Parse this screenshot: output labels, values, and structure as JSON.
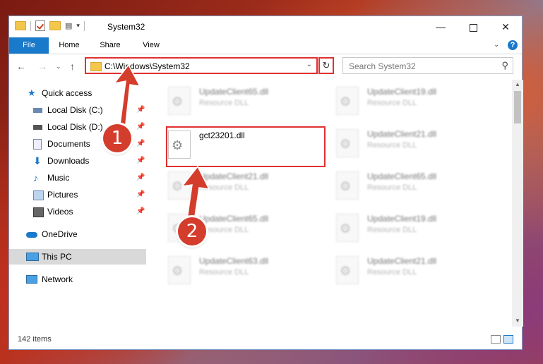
{
  "window": {
    "title": "System32",
    "controls": {
      "minimize": "—",
      "maximize": "",
      "close": "✕"
    }
  },
  "ribbon": {
    "tabs": [
      "File",
      "Home",
      "Share",
      "View"
    ],
    "help": "?"
  },
  "nav": {
    "address_path": "C:\\Windows\\System32",
    "search_placeholder": "Search System32"
  },
  "sidebar": {
    "items": [
      {
        "label": "Quick access",
        "icon": "star-icon"
      },
      {
        "label": "Local Disk (C:)",
        "icon": "drive-icon",
        "pinned": true
      },
      {
        "label": "Local Disk (D:)",
        "icon": "drive-icon",
        "pinned": true
      },
      {
        "label": "Documents",
        "icon": "documents-icon",
        "pinned": true
      },
      {
        "label": "Downloads",
        "icon": "download-icon",
        "pinned": true
      },
      {
        "label": "Music",
        "icon": "music-icon",
        "pinned": true
      },
      {
        "label": "Pictures",
        "icon": "pictures-icon",
        "pinned": true
      },
      {
        "label": "Videos",
        "icon": "videos-icon",
        "pinned": true
      },
      {
        "label": "OneDrive",
        "icon": "cloud-icon"
      },
      {
        "label": "This PC",
        "icon": "computer-icon",
        "selected": true
      },
      {
        "label": "Network",
        "icon": "network-icon"
      }
    ]
  },
  "files": [
    {
      "name": "UpdateClient65.dll",
      "type": "Resource DLL",
      "blurred": true
    },
    {
      "name": "UpdateClient19.dll",
      "type": "Resource DLL",
      "blurred": true
    },
    {
      "name": "gct23201.dll",
      "type": "",
      "blurred": false
    },
    {
      "name": "UpdateClient21.dll",
      "type": "Resource DLL",
      "blurred": true
    },
    {
      "name": "UpdateClient21.dll",
      "type": "Resource DLL",
      "blurred": true
    },
    {
      "name": "UpdateClient65.dll",
      "type": "Resource DLL",
      "blurred": true
    },
    {
      "name": "UpdateClient65.dll",
      "type": "Resource DLL",
      "blurred": true
    },
    {
      "name": "UpdateClient19.dll",
      "type": "Resource DLL",
      "blurred": true
    },
    {
      "name": "UpdateClient63.dll",
      "type": "Resource DLL",
      "blurred": true
    },
    {
      "name": "UpdateClient21.dll",
      "type": "Resource DLL",
      "blurred": true
    }
  ],
  "status": {
    "item_count": "142 items"
  },
  "annotations": {
    "badge1": "1",
    "badge2": "2"
  },
  "colors": {
    "accent": "#1979ca",
    "highlight": "#e03030",
    "badge": "#d43c2c"
  }
}
